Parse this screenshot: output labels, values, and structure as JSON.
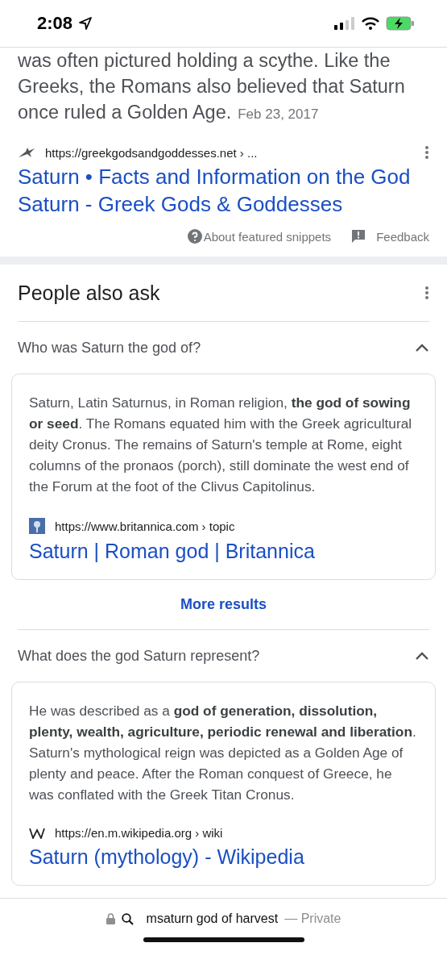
{
  "status_bar": {
    "time": "2:08"
  },
  "featured_snippet": {
    "text": "was often pictured holding a scythe. Like the Greeks, the Romans also believed that Saturn once ruled a Golden Age.",
    "date": "Feb 23, 2017",
    "source_url": "https://greekgodsandgoddesses.net › ...",
    "title": "Saturn • Facts and Information on the God Saturn - Greek Gods & Goddesses",
    "about_link": "About featured snippets",
    "feedback_link": "Feedback"
  },
  "people_also_ask": {
    "heading": "People also ask",
    "questions": [
      {
        "question": "Who was Saturn the god of?",
        "expanded": true,
        "answer": "Saturn, Latin Saturnus, in Roman religion, **the god of sowing or seed**. The Romans equated him with the Greek agricultural deity Cronus. The remains of Saturn's temple at Rome, eight columns of the pronaos (porch), still dominate the west end of the Forum at the foot of the Clivus Capitolinus.",
        "kind": "britannica",
        "source_url": "https://www.britannica.com › topic",
        "title": "Saturn | Roman god | Britannica",
        "more": "More results"
      },
      {
        "question": "What does the god Saturn represent?",
        "expanded": true,
        "answer": "He was described as a **god of generation, dissolution, plenty, wealth, agriculture, periodic renewal and liberation**. Saturn's mythological reign was depicted as a Golden Age of plenty and peace. After the Roman conquest of Greece, he was conflated with the Greek Titan Cronus.",
        "kind": "wikipedia",
        "source_url": "https://en.m.wikipedia.org › wiki",
        "title": "Saturn (mythology) - Wikipedia"
      }
    ]
  },
  "address_bar": {
    "query": "msaturn god of harvest",
    "mode": "— Private"
  }
}
